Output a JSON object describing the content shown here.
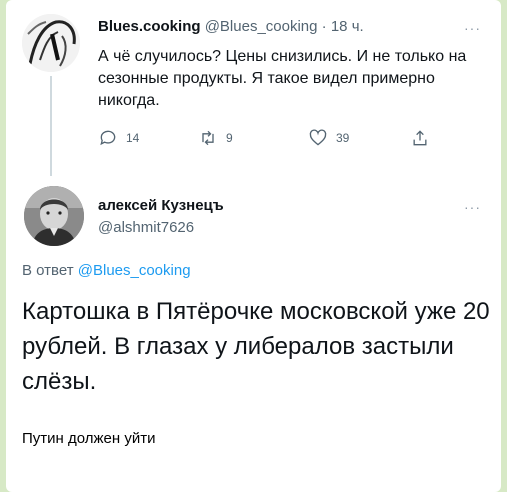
{
  "tweet1": {
    "name": "Blues.cooking",
    "handle": "@Blues_cooking",
    "time": "18 ч.",
    "text": "А чё случилось? Цены снизились. И не только на сезонные продукты. Я такое видел примерно никогда.",
    "replies": "14",
    "retweets": "9",
    "likes": "39"
  },
  "tweet2": {
    "name": "алексей Кузнецъ",
    "handle": "@alshmit7626",
    "reply_prefix": "В ответ",
    "reply_handle": "@Blues_cooking",
    "text": "Картошка в Пятёрочке московской уже 20 рублей. В глазах у либералов застыли слёзы."
  },
  "caption": "Путин должен уйти",
  "more_glyph": "···",
  "icons": [
    "reply-icon",
    "retweet-icon",
    "like-icon",
    "share-icon"
  ]
}
